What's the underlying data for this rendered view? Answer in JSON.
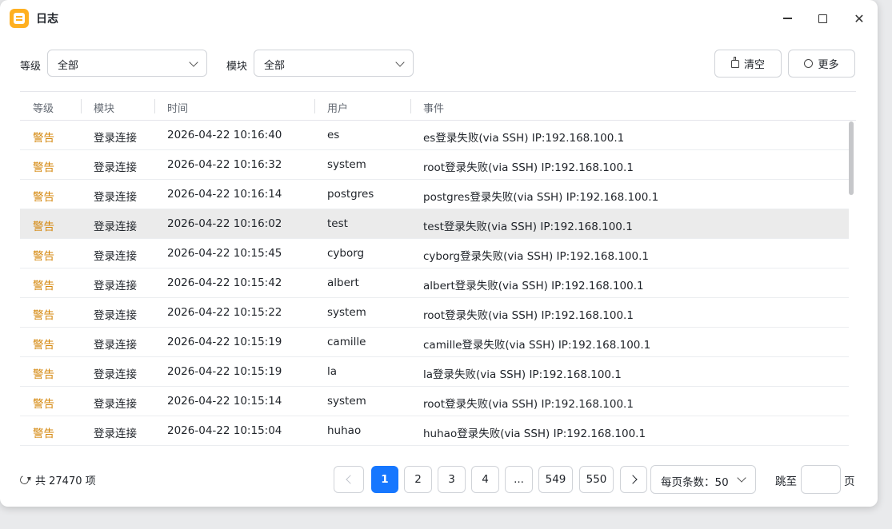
{
  "window": {
    "title": "日志"
  },
  "filters": {
    "level_label": "等级",
    "level_value": "全部",
    "module_label": "模块",
    "module_value": "全部"
  },
  "toolbar": {
    "clear_label": "清空",
    "more_label": "更多"
  },
  "table": {
    "columns": [
      "等级",
      "模块",
      "时间",
      "用户",
      "事件"
    ],
    "rows": [
      {
        "level": "警告",
        "module": "登录连接",
        "time": "2026-04-22 10:16:40",
        "user": "es",
        "event": "es登录失败(via SSH) IP:192.168.100.1"
      },
      {
        "level": "警告",
        "module": "登录连接",
        "time": "2026-04-22 10:16:32",
        "user": "system",
        "event": "root登录失败(via SSH) IP:192.168.100.1"
      },
      {
        "level": "警告",
        "module": "登录连接",
        "time": "2026-04-22 10:16:14",
        "user": "postgres",
        "event": "postgres登录失败(via SSH) IP:192.168.100.1"
      },
      {
        "level": "警告",
        "module": "登录连接",
        "time": "2026-04-22 10:16:02",
        "user": "test",
        "event": "test登录失败(via SSH) IP:192.168.100.1"
      },
      {
        "level": "警告",
        "module": "登录连接",
        "time": "2026-04-22 10:15:45",
        "user": "cyborg",
        "event": "cyborg登录失败(via SSH) IP:192.168.100.1"
      },
      {
        "level": "警告",
        "module": "登录连接",
        "time": "2026-04-22 10:15:42",
        "user": "albert",
        "event": "albert登录失败(via SSH) IP:192.168.100.1"
      },
      {
        "level": "警告",
        "module": "登录连接",
        "time": "2026-04-22 10:15:22",
        "user": "system",
        "event": "root登录失败(via SSH) IP:192.168.100.1"
      },
      {
        "level": "警告",
        "module": "登录连接",
        "time": "2026-04-22 10:15:19",
        "user": "camille",
        "event": "camille登录失败(via SSH) IP:192.168.100.1"
      },
      {
        "level": "警告",
        "module": "登录连接",
        "time": "2026-04-22 10:15:19",
        "user": "la",
        "event": "la登录失败(via SSH) IP:192.168.100.1"
      },
      {
        "level": "警告",
        "module": "登录连接",
        "time": "2026-04-22 10:15:14",
        "user": "system",
        "event": "root登录失败(via SSH) IP:192.168.100.1"
      },
      {
        "level": "警告",
        "module": "登录连接",
        "time": "2026-04-22 10:15:04",
        "user": "huhao",
        "event": "huhao登录失败(via SSH) IP:192.168.100.1"
      }
    ]
  },
  "footer": {
    "total_text": "共 27470 项",
    "pages": [
      "1",
      "2",
      "3",
      "4",
      "...",
      "549",
      "550"
    ],
    "current_page": "1",
    "page_size_text": "每页条数：50",
    "jump_label": "跳至",
    "jump_unit": "页",
    "jump_value": ""
  },
  "colors": {
    "accent": "#1677ff",
    "warning": "#d4860a",
    "selected_row": "#ebebeb"
  }
}
